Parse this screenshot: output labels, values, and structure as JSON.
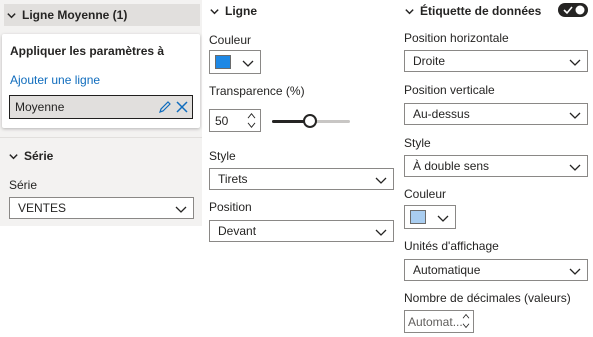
{
  "left": {
    "line_header": "Ligne Moyenne (1)",
    "apply_title": "Appliquer les paramètres à",
    "add_line": "Ajouter une ligne",
    "line_name": "Moyenne",
    "serie_header": "Série",
    "serie_label": "Série",
    "serie_value": "VENTES"
  },
  "middle": {
    "header": "Ligne",
    "color_label": "Couleur",
    "color_value": "#1e88e5",
    "transparency_label": "Transparence (%)",
    "transparency_value": "50",
    "transparency_fraction": 0.5,
    "style_label": "Style",
    "style_value": "Tirets",
    "position_label": "Position",
    "position_value": "Devant"
  },
  "right": {
    "header": "Étiquette de données",
    "toggle_on": true,
    "hpos_label": "Position horizontale",
    "hpos_value": "Droite",
    "vpos_label": "Position verticale",
    "vpos_value": "Au-dessus",
    "style_label": "Style",
    "style_value": "À double sens",
    "color_label": "Couleur",
    "color_value": "#a9cdf0",
    "units_label": "Unités d'affichage",
    "units_value": "Automatique",
    "decimals_label": "Nombre de décimales (valeurs)",
    "decimals_value": "Automat..."
  },
  "colors": {
    "accent": "#0f6cbd",
    "header_bg": "#f3f2f1",
    "text": "#252423"
  }
}
